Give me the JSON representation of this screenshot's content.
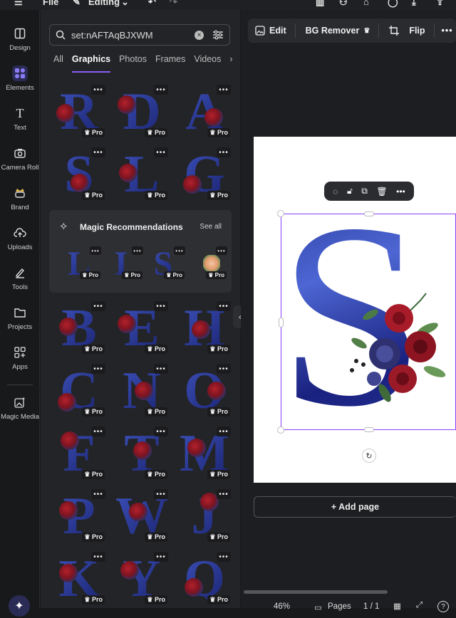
{
  "topbar": {
    "menu": "☰",
    "file": "File",
    "editing": "Editing"
  },
  "rail": {
    "items": [
      {
        "label": "Design"
      },
      {
        "label": "Elements"
      },
      {
        "label": "Text"
      },
      {
        "label": "Camera Roll"
      },
      {
        "label": "Brand"
      },
      {
        "label": "Uploads"
      },
      {
        "label": "Tools"
      },
      {
        "label": "Projects"
      },
      {
        "label": "Apps"
      },
      {
        "label": "Magic Media"
      }
    ]
  },
  "search": {
    "value": "set:nAFTAqBJXWM"
  },
  "tabs": [
    "All",
    "Graphics",
    "Photos",
    "Frames",
    "Videos"
  ],
  "tiles": {
    "row1": [
      "R",
      "D",
      "A"
    ],
    "row2": [
      "S",
      "L",
      "G"
    ],
    "row3": [
      "B",
      "E",
      "H"
    ],
    "row4": [
      "C",
      "N",
      "O"
    ],
    "row5": [
      "F",
      "T",
      "M"
    ],
    "row6": [
      "P",
      "W",
      "J"
    ],
    "row7": [
      "K",
      "Y",
      "Q"
    ],
    "pro": "Pro",
    "more": "•••"
  },
  "magic": {
    "title": "Magic Recommendations",
    "see_all": "See all",
    "letters": [
      "L",
      "I",
      "S",
      ""
    ]
  },
  "context_bar": {
    "edit": "Edit",
    "bg_remover": "BG Remover",
    "flip": "Flip"
  },
  "canvas": {
    "letter": "S"
  },
  "add_page": "+ Add page",
  "footer": {
    "zoom": "46%",
    "pages": "Pages",
    "page_count": "1 / 1"
  }
}
